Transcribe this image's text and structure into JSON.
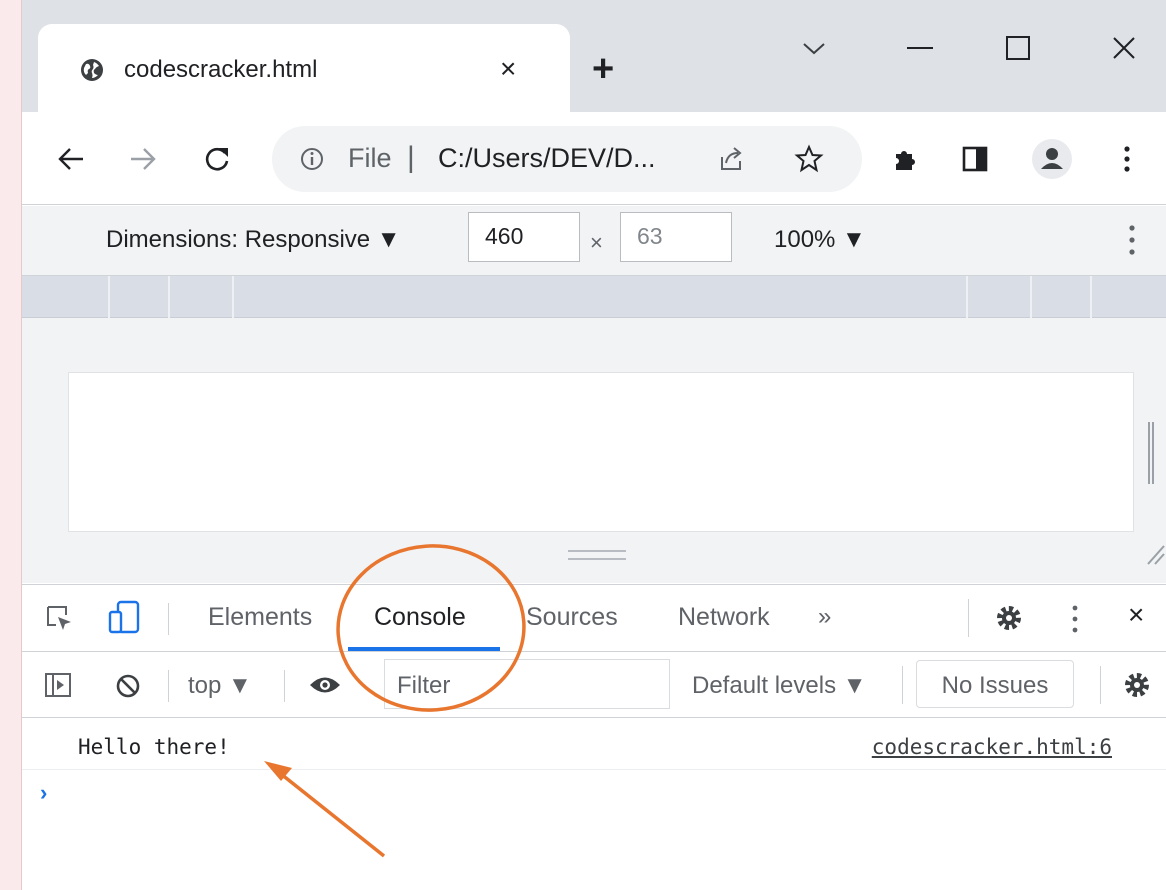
{
  "browser": {
    "tab": {
      "title": "codescracker.html",
      "favicon": "globe-icon",
      "close": "×"
    },
    "new_tab": "+",
    "window_controls": [
      "chevron-down-icon",
      "minimize-icon",
      "maximize-icon",
      "close-icon"
    ]
  },
  "address_bar": {
    "scheme_label": "File",
    "separator": "|",
    "url": "C:/Users/DEV/D..."
  },
  "device_toolbar": {
    "dimensions": "Dimensions: Responsive ▼",
    "width": "460",
    "times": "×",
    "height": "63",
    "zoom": "100% ▼"
  },
  "devtools": {
    "tabs": [
      {
        "label": "Elements"
      },
      {
        "label": "Console",
        "active": true
      },
      {
        "label": "Sources"
      },
      {
        "label": "Network"
      }
    ],
    "overflow": "»",
    "close": "×"
  },
  "console": {
    "context": "top ▼",
    "filter_placeholder": "Filter",
    "levels": "Default levels ▼",
    "issues": "No Issues",
    "log_message": "Hello there!",
    "log_source": "codescracker.html:6",
    "prompt": "›"
  },
  "colors": {
    "accent": "#1a73e8",
    "annotation": "#e8762f",
    "tab_strip": "#dee1e6"
  }
}
